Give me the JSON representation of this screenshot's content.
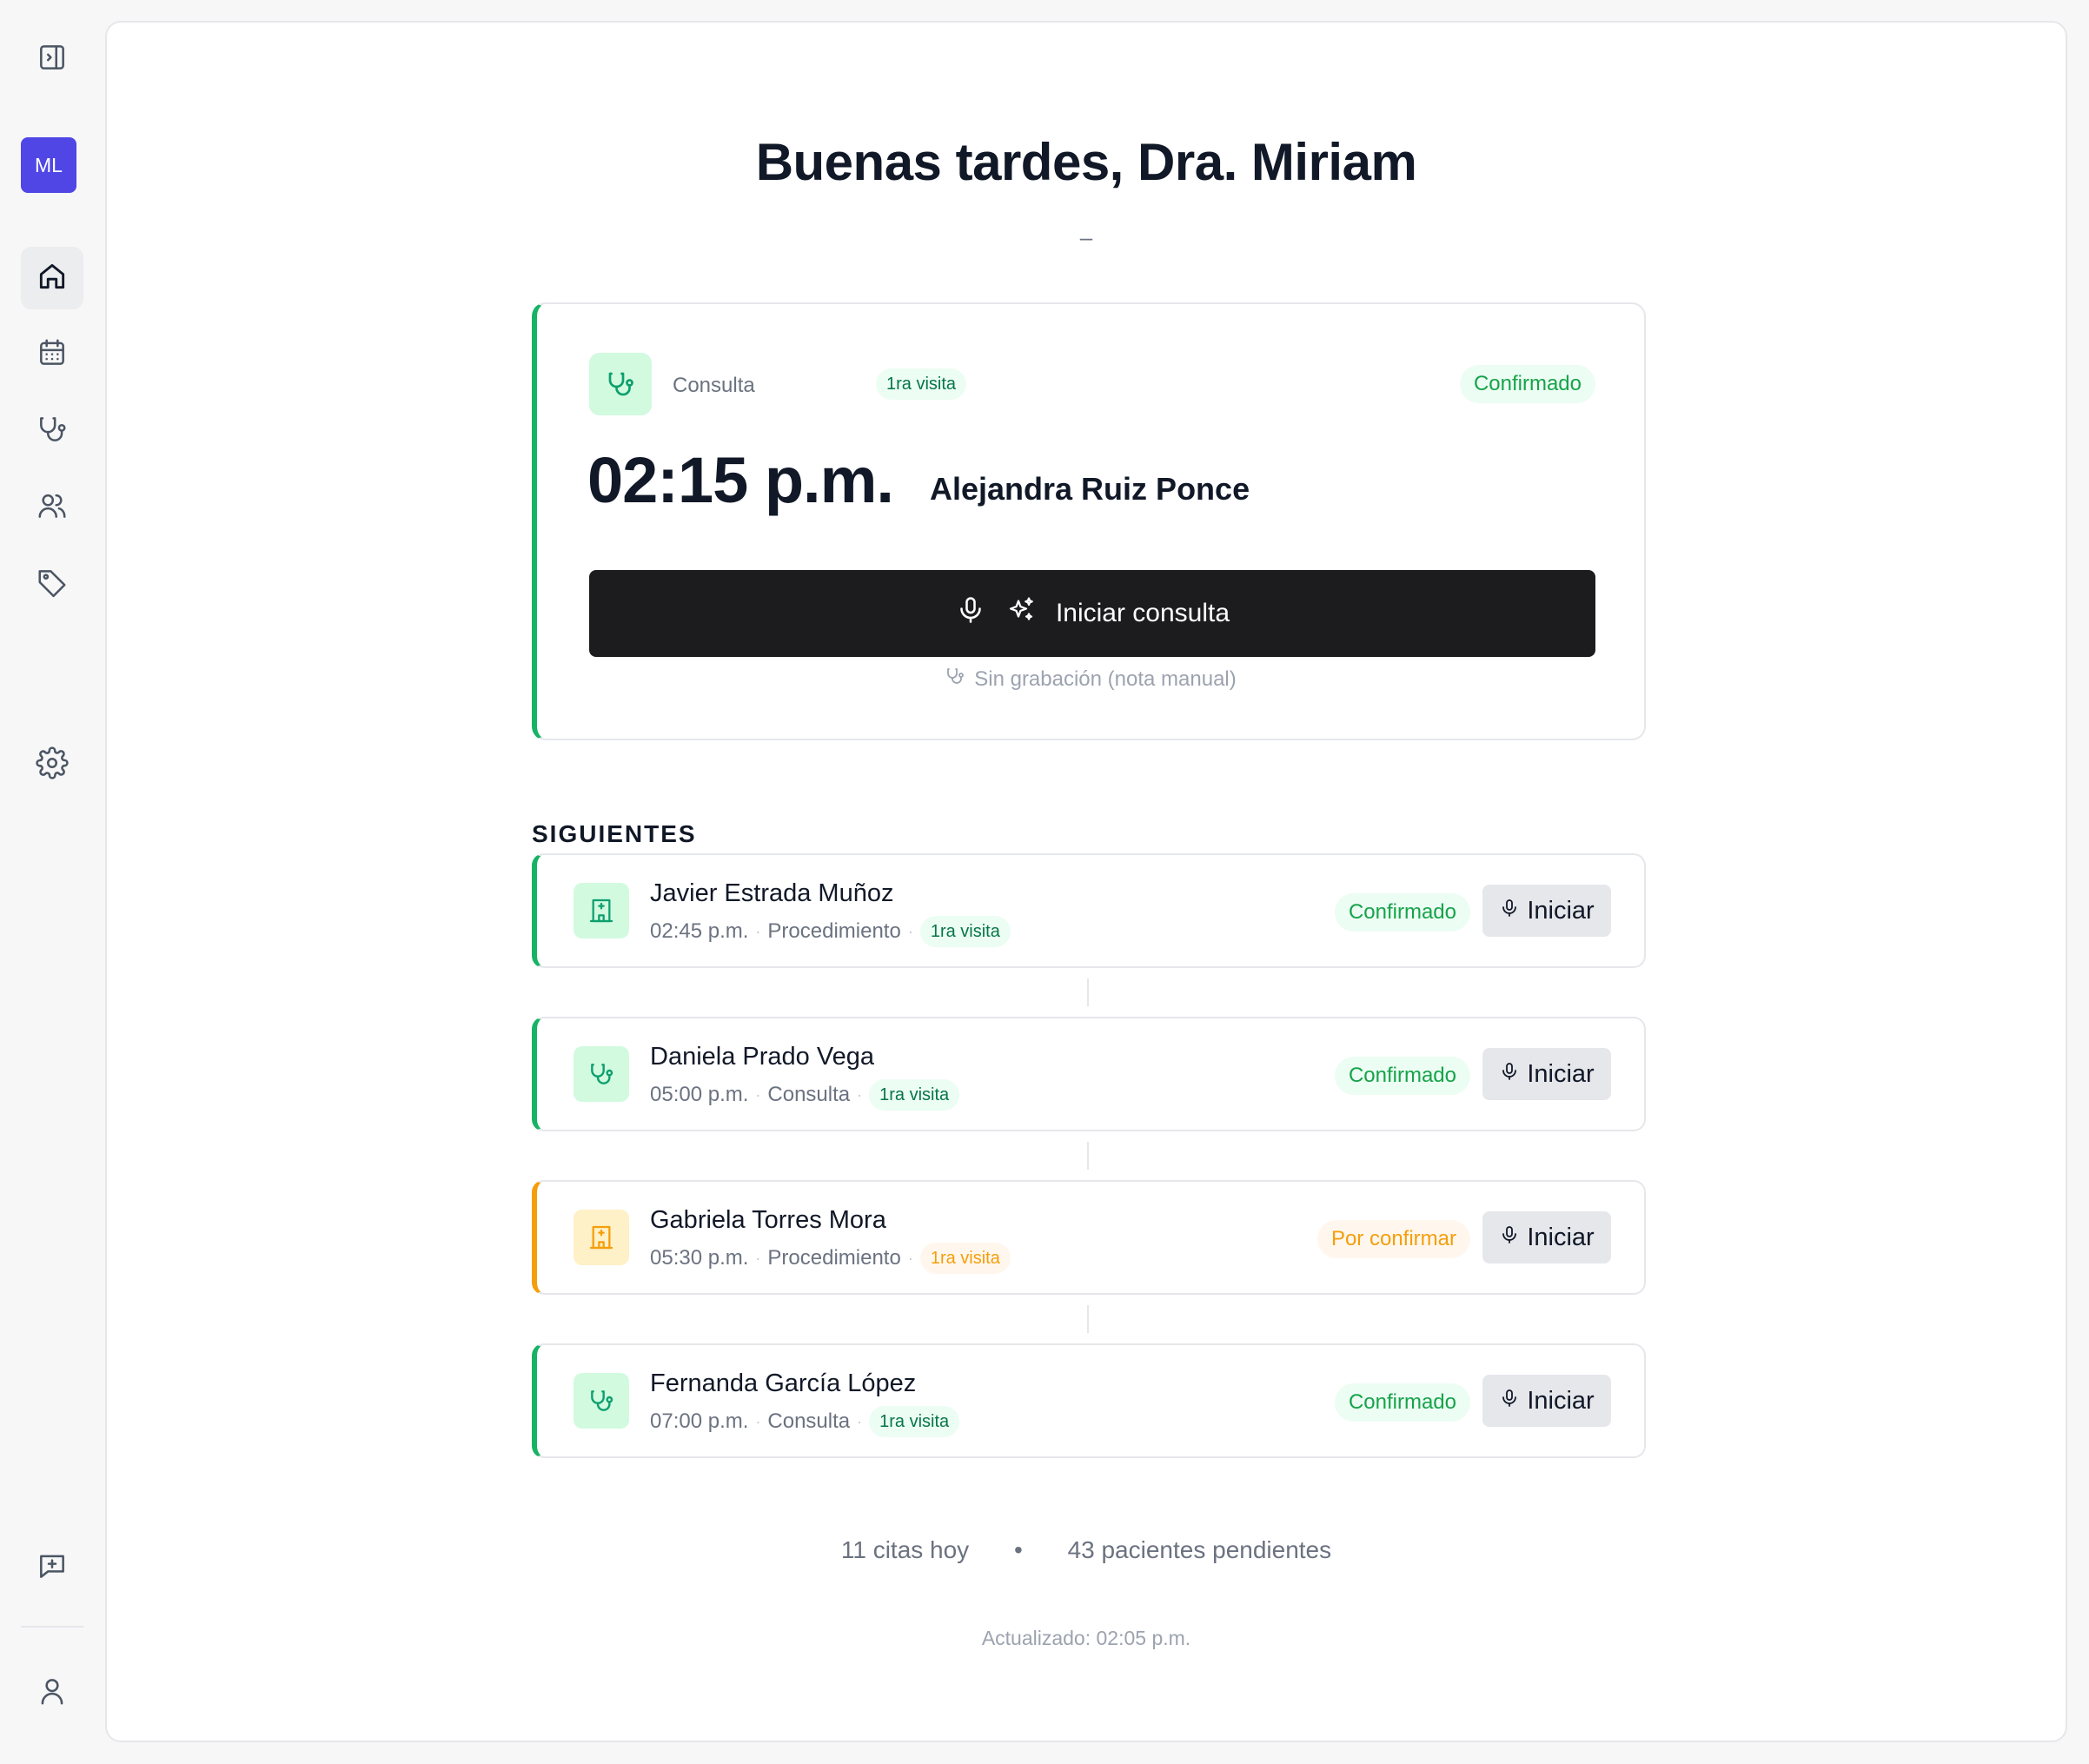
{
  "user": {
    "initials": "ML"
  },
  "sidebar": {
    "items": [
      {
        "name": "home",
        "icon": "home-icon",
        "active": true
      },
      {
        "name": "calendar",
        "icon": "calendar-icon"
      },
      {
        "name": "consultations",
        "icon": "stethoscope-icon"
      },
      {
        "name": "patients",
        "icon": "users-icon"
      },
      {
        "name": "tags",
        "icon": "tag-icon"
      },
      {
        "name": "settings",
        "icon": "gear-icon"
      }
    ],
    "bottom": [
      {
        "name": "feedback",
        "icon": "message-plus-icon"
      },
      {
        "name": "profile",
        "icon": "user-icon"
      }
    ]
  },
  "header": {
    "greeting": "Buenas tardes, Dra. Miriam",
    "subline": "–"
  },
  "current": {
    "type": "Consulta",
    "tag": "1ra visita",
    "status": "Confirmado",
    "time": "02:15 p.m.",
    "patient": "Alejandra Ruiz Ponce",
    "start_label": "Iniciar consulta",
    "manual_label": "Sin grabación (nota manual)"
  },
  "upcoming": {
    "title": "SIGUIENTES",
    "items": [
      {
        "name": "Javier Estrada Muñoz",
        "time": "02:45 p.m.",
        "type": "Procedimiento",
        "tag": "1ra visita",
        "status": "Confirmado",
        "button": "Iniciar",
        "icon": "hospital-icon",
        "color": "green"
      },
      {
        "name": "Daniela Prado Vega",
        "time": "05:00 p.m.",
        "type": "Consulta",
        "tag": "1ra visita",
        "status": "Confirmado",
        "button": "Iniciar",
        "icon": "stethoscope-icon",
        "color": "green"
      },
      {
        "name": "Gabriela Torres Mora",
        "time": "05:30 p.m.",
        "type": "Procedimiento",
        "tag": "1ra visita",
        "status": "Por confirmar",
        "button": "Iniciar",
        "icon": "hospital-icon",
        "color": "orange"
      },
      {
        "name": "Fernanda García López",
        "time": "07:00 p.m.",
        "type": "Consulta",
        "tag": "1ra visita",
        "status": "Confirmado",
        "button": "Iniciar",
        "icon": "stethoscope-icon",
        "color": "green"
      }
    ]
  },
  "stats": {
    "appointments": "11 citas hoy",
    "separator": "•",
    "pending": "43 pacientes pendientes"
  },
  "updated": "Actualizado: 02:05 p.m.",
  "colors": {
    "accent_green": "#16b364",
    "accent_orange": "#f59e0b",
    "avatar": "#4f46e5",
    "primary_button": "#1c1c1e"
  }
}
